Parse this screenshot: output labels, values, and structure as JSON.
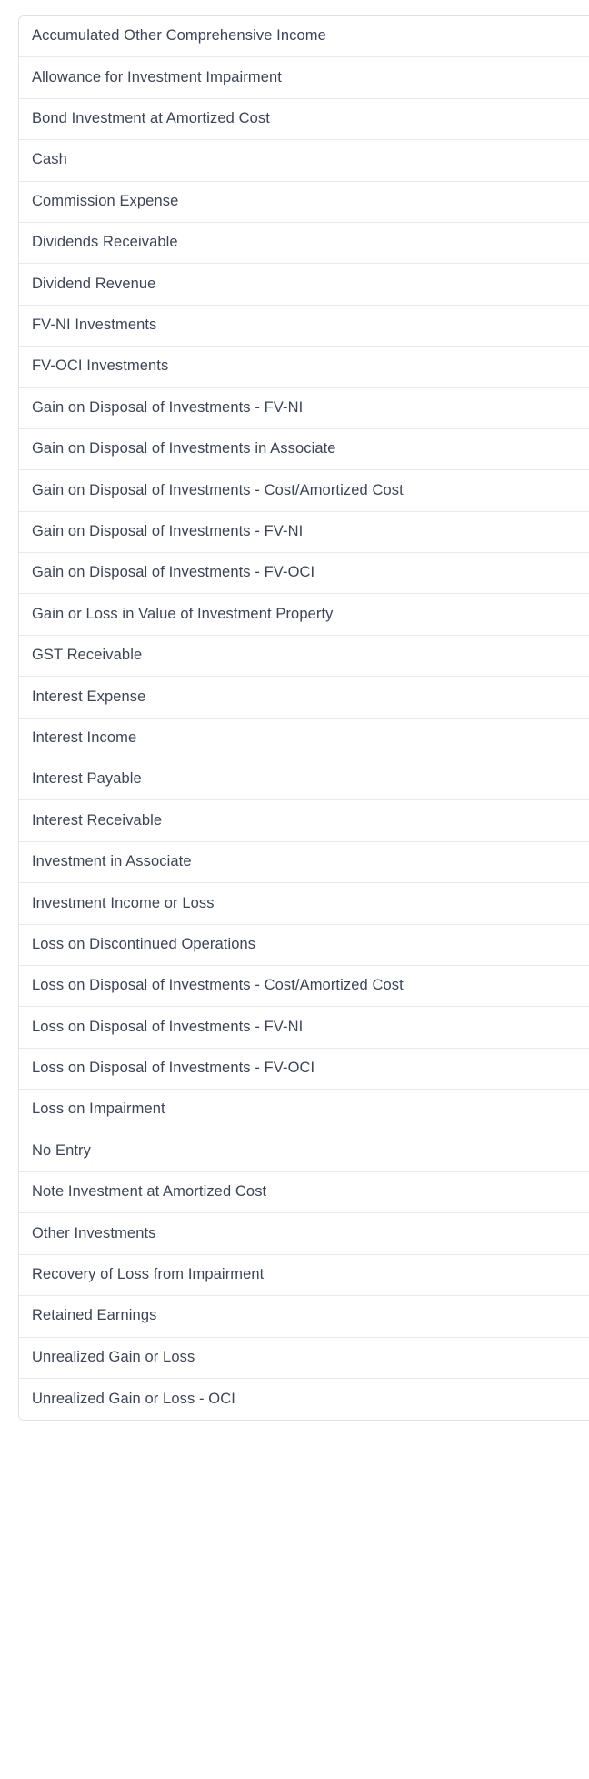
{
  "panel": {
    "type": "dropdown-option-list",
    "background_color": "#ffffff",
    "border_color": "#e0e1e5",
    "divider_color": "#e8e9ec",
    "text_color": "#3c4458"
  },
  "account_list": {
    "options": [
      {
        "label": "Accumulated Other Comprehensive Income"
      },
      {
        "label": "Allowance for Investment Impairment"
      },
      {
        "label": "Bond Investment at Amortized Cost"
      },
      {
        "label": "Cash"
      },
      {
        "label": "Commission Expense"
      },
      {
        "label": "Dividends Receivable"
      },
      {
        "label": "Dividend Revenue"
      },
      {
        "label": "FV-NI Investments"
      },
      {
        "label": "FV-OCI Investments"
      },
      {
        "label": "Gain on Disposal of Investments - FV-NI"
      },
      {
        "label": "Gain on Disposal of Investments in Associate"
      },
      {
        "label": "Gain on Disposal of Investments - Cost/Amortized Cost"
      },
      {
        "label": "Gain on Disposal of Investments - FV-NI"
      },
      {
        "label": "Gain on Disposal of Investments - FV-OCI"
      },
      {
        "label": "Gain or Loss in Value of Investment Property"
      },
      {
        "label": "GST Receivable"
      },
      {
        "label": "Interest Expense"
      },
      {
        "label": "Interest Income"
      },
      {
        "label": "Interest Payable"
      },
      {
        "label": "Interest Receivable"
      },
      {
        "label": "Investment in Associate"
      },
      {
        "label": "Investment Income or Loss"
      },
      {
        "label": "Loss on Discontinued Operations"
      },
      {
        "label": "Loss on Disposal of Investments - Cost/Amortized Cost"
      },
      {
        "label": "Loss on Disposal of Investments - FV-NI"
      },
      {
        "label": "Loss on Disposal of Investments - FV-OCI"
      },
      {
        "label": "Loss on Impairment"
      },
      {
        "label": "No Entry"
      },
      {
        "label": "Note Investment at Amortized Cost"
      },
      {
        "label": "Other Investments"
      },
      {
        "label": "Recovery of Loss from Impairment"
      },
      {
        "label": "Retained Earnings"
      },
      {
        "label": "Unrealized Gain or Loss"
      },
      {
        "label": "Unrealized Gain or Loss - OCI"
      }
    ]
  }
}
